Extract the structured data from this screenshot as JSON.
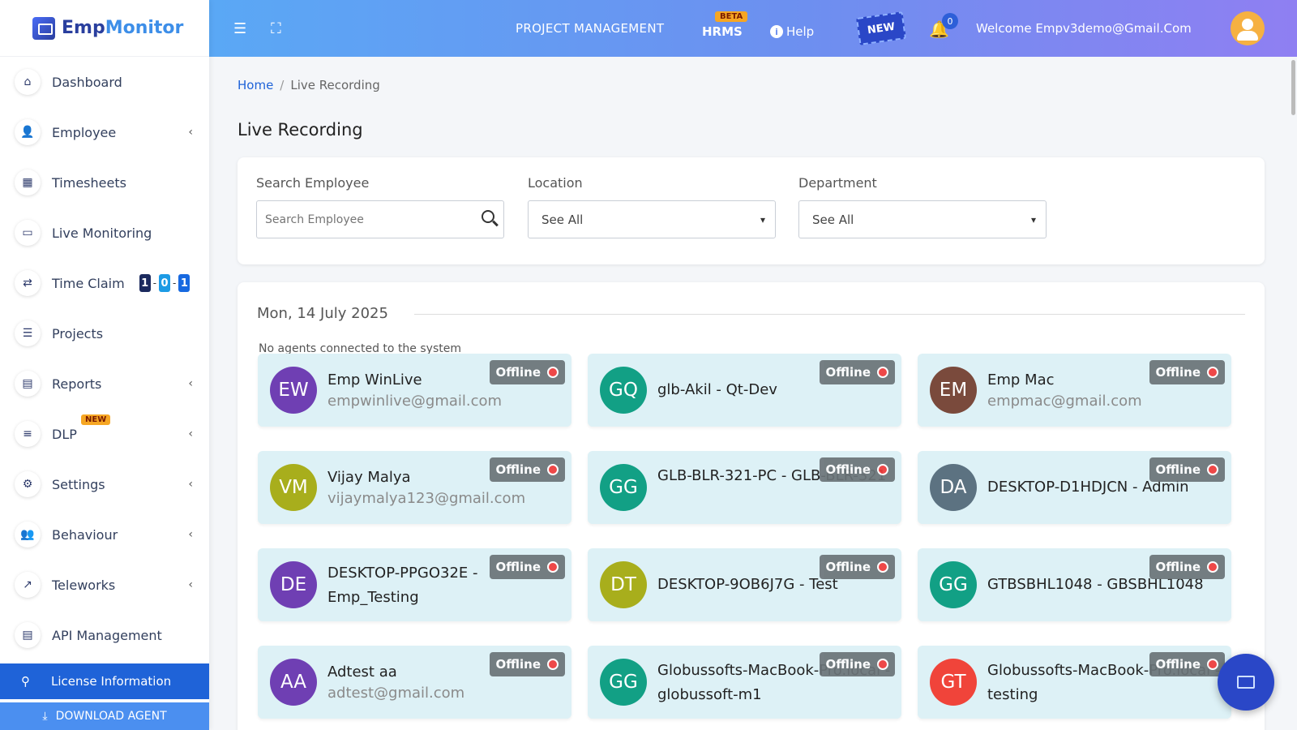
{
  "brand": {
    "name_part1": "Emp",
    "name_part2": "Monitor"
  },
  "sidebar": {
    "items": [
      {
        "label": "Dashboard",
        "icon": "home-icon",
        "glyph": "⌂",
        "chevron": false
      },
      {
        "label": "Employee",
        "icon": "employee-icon",
        "glyph": "👤",
        "chevron": true
      },
      {
        "label": "Timesheets",
        "icon": "calendar-icon",
        "glyph": "▦",
        "chevron": false
      },
      {
        "label": "Live Monitoring",
        "icon": "monitor-icon",
        "glyph": "▭",
        "chevron": false
      },
      {
        "label": "Time Claim",
        "icon": "swap-icon",
        "glyph": "⇄",
        "chevron": false
      },
      {
        "label": "Projects",
        "icon": "list-icon",
        "glyph": "☰",
        "chevron": false
      },
      {
        "label": "Reports",
        "icon": "report-icon",
        "glyph": "▤",
        "chevron": true
      },
      {
        "label": "DLP",
        "icon": "sliders-icon",
        "glyph": "≡",
        "chevron": true,
        "badge": "NEW"
      },
      {
        "label": "Settings",
        "icon": "gear-icon",
        "glyph": "⚙",
        "chevron": true
      },
      {
        "label": "Behaviour",
        "icon": "users-cog-icon",
        "glyph": "👥",
        "chevron": true
      },
      {
        "label": "Teleworks",
        "icon": "chart-icon",
        "glyph": "↗",
        "chevron": true
      },
      {
        "label": "API Management",
        "icon": "api-icon",
        "glyph": "▤",
        "chevron": false
      }
    ],
    "time_claim_counter": [
      "1",
      "0",
      "1"
    ],
    "license_label": "License Information",
    "download_label": "DOWNLOAD AGENT"
  },
  "header": {
    "project_management": "PROJECT MANAGEMENT",
    "hrms": "HRMS",
    "beta_badge": "BETA",
    "help": "Help",
    "new_stamp": "NEW",
    "notification_count": "0",
    "welcome": "Welcome  Empv3demo@Gmail.Com"
  },
  "breadcrumb": {
    "home": "Home",
    "current": "Live Recording"
  },
  "page_title": "Live Recording",
  "filters": {
    "search_label": "Search Employee",
    "search_placeholder": "Search Employee",
    "location_label": "Location",
    "location_value": "See All",
    "department_label": "Department",
    "department_value": "See All"
  },
  "list": {
    "date": "Mon, 14 July 2025",
    "no_agents": "No agents connected to the system",
    "status_label": "Offline",
    "agents": [
      {
        "initials": "EW",
        "name": "Emp WinLive",
        "email": "empwinlive@gmail.com",
        "color": "#6f3fb3"
      },
      {
        "initials": "GQ",
        "name": "glb-Akil - Qt-Dev",
        "email": "",
        "color": "#12a085"
      },
      {
        "initials": "EM",
        "name": "Emp Mac",
        "email": "empmac@gmail.com",
        "color": "#7a4a3c"
      },
      {
        "initials": "VM",
        "name": "Vijay Malya",
        "email": "vijaymalya123@gmail.com",
        "color": "#a8ae1c"
      },
      {
        "initials": "GG",
        "name": "GLB-BLR-321-PC - GLB-BLR-321",
        "email": "",
        "color": "#12a085"
      },
      {
        "initials": "DA",
        "name": "DESKTOP-D1HDJCN - Admin",
        "email": "",
        "color": "#5c7281"
      },
      {
        "initials": "DE",
        "name": "DESKTOP-PPGO32E - Emp_Testing",
        "email": "",
        "color": "#6f3fb3"
      },
      {
        "initials": "DT",
        "name": "DESKTOP-9OB6J7G - Test",
        "email": "",
        "color": "#a8ae1c"
      },
      {
        "initials": "GG",
        "name": "GTBSBHL1048 - GBSBHL1048",
        "email": "",
        "color": "#12a085"
      },
      {
        "initials": "AA",
        "name": "Adtest aa",
        "email": "adtest@gmail.com",
        "color": "#6f3fb3"
      },
      {
        "initials": "GG",
        "name": "Globussofts-MacBook-Pro.local - globussoft-m1",
        "email": "",
        "color": "#12a085"
      },
      {
        "initials": "GT",
        "name": "Globussofts-MacBook-Pro.local - testing",
        "email": "",
        "color": "#f0443a"
      }
    ]
  }
}
